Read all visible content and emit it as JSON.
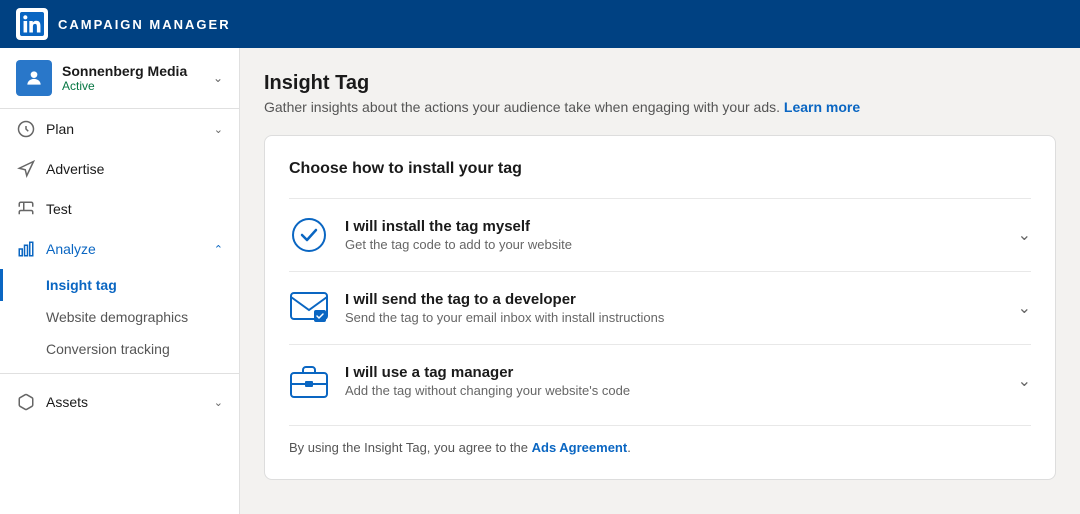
{
  "topNav": {
    "title": "CAMPAIGN MANAGER"
  },
  "sidebar": {
    "account": {
      "name": "Sonnenberg Media",
      "status": "Active"
    },
    "navItems": [
      {
        "id": "plan",
        "label": "Plan",
        "hasChevron": true
      },
      {
        "id": "advertise",
        "label": "Advertise",
        "hasChevron": false
      },
      {
        "id": "test",
        "label": "Test",
        "hasChevron": false
      },
      {
        "id": "analyze",
        "label": "Analyze",
        "hasChevron": true,
        "active": true
      }
    ],
    "analyzeSubItems": [
      {
        "id": "insight-tag",
        "label": "Insight tag",
        "active": true
      },
      {
        "id": "website-demographics",
        "label": "Website demographics",
        "active": false
      },
      {
        "id": "conversion-tracking",
        "label": "Conversion tracking",
        "active": false
      }
    ],
    "assetsItem": {
      "label": "Assets",
      "hasChevron": true
    }
  },
  "mainContent": {
    "pageTitle": "Insight Tag",
    "pageDescription": "Gather insights about the actions your audience take when engaging with your ads.",
    "learnMoreLabel": "Learn more",
    "cardTitle": "Choose how to install your tag",
    "options": [
      {
        "id": "install-myself",
        "title": "I will install the tag myself",
        "subtitle": "Get the tag code to add to your website",
        "iconType": "check-circle"
      },
      {
        "id": "send-developer",
        "title": "I will send the tag to a developer",
        "subtitle": "Send the tag to your email inbox with install instructions",
        "iconType": "email"
      },
      {
        "id": "tag-manager",
        "title": "I will use a tag manager",
        "subtitle": "Add the tag without changing your website's code",
        "iconType": "briefcase"
      }
    ],
    "footerText": "By using the Insight Tag, you agree to the",
    "footerLinkLabel": "Ads Agreement",
    "footerPeriod": "."
  }
}
